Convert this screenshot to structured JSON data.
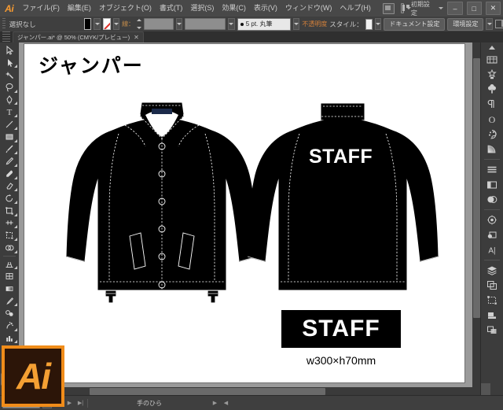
{
  "app": {
    "name": "Ai",
    "workspace": "初期設定",
    "window_buttons": {
      "minimize": "–",
      "maximize": "□",
      "close": "✕"
    }
  },
  "menubar": {
    "items": [
      {
        "label": "ファイル(F)"
      },
      {
        "label": "編集(E)"
      },
      {
        "label": "オブジェクト(O)"
      },
      {
        "label": "書式(T)"
      },
      {
        "label": "選択(S)"
      },
      {
        "label": "効果(C)"
      },
      {
        "label": "表示(V)"
      },
      {
        "label": "ウィンドウ(W)"
      },
      {
        "label": "ヘルプ(H)"
      }
    ]
  },
  "controlbar": {
    "selection_status": "選択なし",
    "fill_color": "#000000",
    "stroke_color": "none",
    "stroke_weight_value": "",
    "stroke_profile": "5 pt. 丸筆",
    "opacity_label": "不透明度",
    "style_label": "スタイル：",
    "document_setup_button": "ドキュメント設定",
    "preferences_button": "環境設定"
  },
  "tabbar": {
    "document_title": "ジャンパー.ai* @ 50% (CMYK/プレビュー)",
    "close_glyph": "✕"
  },
  "toolbar": {
    "tools": [
      {
        "name": "selection-tool"
      },
      {
        "name": "direct-selection-tool"
      },
      {
        "name": "magic-wand-tool"
      },
      {
        "name": "lasso-tool"
      },
      {
        "name": "pen-tool"
      },
      {
        "name": "type-tool"
      },
      {
        "name": "line-segment-tool"
      },
      {
        "name": "rectangle-tool"
      },
      {
        "name": "paintbrush-tool"
      },
      {
        "name": "pencil-tool"
      },
      {
        "name": "blob-brush-tool"
      },
      {
        "name": "eraser-tool"
      },
      {
        "name": "rotate-tool"
      },
      {
        "name": "scale-tool"
      },
      {
        "name": "width-tool"
      },
      {
        "name": "free-transform-tool"
      },
      {
        "name": "shape-builder-tool"
      },
      {
        "name": "perspective-grid-tool"
      },
      {
        "name": "mesh-tool"
      },
      {
        "name": "gradient-tool"
      },
      {
        "name": "eyedropper-tool"
      },
      {
        "name": "blend-tool"
      },
      {
        "name": "symbol-sprayer-tool"
      },
      {
        "name": "column-graph-tool"
      },
      {
        "name": "artboard-tool"
      },
      {
        "name": "slice-tool"
      },
      {
        "name": "hand-tool",
        "active": true
      },
      {
        "name": "zoom-tool"
      }
    ]
  },
  "rightdock": {
    "panels": [
      {
        "name": "color-guide-panel"
      },
      {
        "name": "symbols-panel"
      },
      {
        "name": "brushes-panel"
      },
      {
        "name": "paragraph-panel"
      },
      {
        "name": "character-panel"
      },
      {
        "name": "color-panel"
      },
      {
        "name": "gradient-panel"
      },
      {
        "name": "align-panel"
      },
      {
        "name": "stroke-panel"
      },
      {
        "name": "transparency-panel"
      },
      {
        "name": "appearance-panel"
      },
      {
        "name": "graphic-styles-panel"
      },
      {
        "name": "links-panel"
      },
      {
        "name": "layers-panel"
      },
      {
        "name": "artboards-panel"
      },
      {
        "name": "transform-panel"
      },
      {
        "name": "pathfinder-panel"
      },
      {
        "name": "navigator-panel"
      }
    ]
  },
  "artwork": {
    "title": "ジャンパー",
    "back_print_text": "STAFF",
    "label_box_text": "STAFF",
    "dimensions_caption": "w300×h70mm",
    "garment_color": "#000000",
    "stitch_color": "#e8e8e8"
  },
  "statusbar": {
    "zoom_level": "50%",
    "active_tool": "手のひら"
  }
}
